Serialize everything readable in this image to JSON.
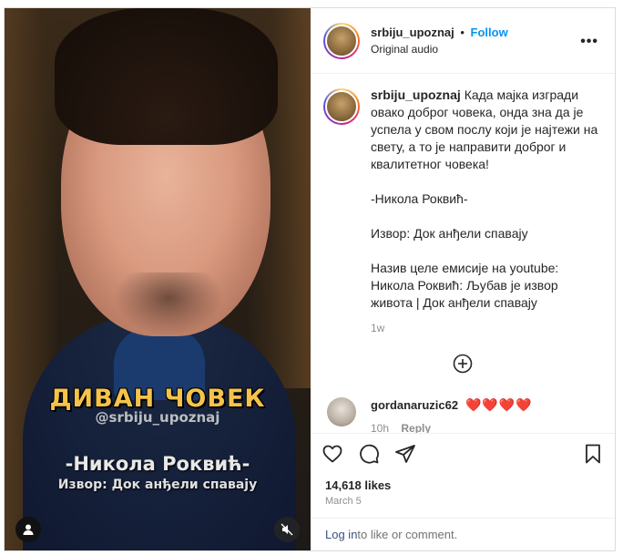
{
  "post": {
    "username": "srbiju_upoznaj",
    "separator": "•",
    "follow_label": "Follow",
    "audio": "Original audio",
    "more_label": "•••"
  },
  "video_overlay": {
    "title": "ДИВАН ЧОВЕК",
    "handle": "@srbiju_upoznaj",
    "name": "-Никола Роквић-",
    "source": "Извор: Док анђели спавају"
  },
  "caption": {
    "username": "srbiju_upoznaj",
    "paragraphs": [
      "Када мајка изгради овако доброг човека, онда зна да је успела у свом послу који је најтежи на свету, а то је направити доброг и квалитетног човека!",
      "-Никола Роквић-",
      "Извор: Док анђели спавају",
      "Назив целе емисије на youtube: Никола Роквић: Љубав је извор живота | Док анђели спавају"
    ],
    "time": "1w"
  },
  "comment": {
    "username": "gordanaruzic62",
    "text": "❤️❤️❤️❤️",
    "time": "10h",
    "reply_label": "Reply"
  },
  "stats": {
    "likes": "14,618 likes",
    "date": "March 5"
  },
  "login": {
    "link": "Log in",
    "rest": " to like or comment."
  },
  "icons": {
    "like": "heart-icon",
    "comment": "comment-icon",
    "share": "share-icon",
    "save": "bookmark-icon",
    "more": "more-icon",
    "add": "add-circle-icon",
    "user": "user-icon",
    "mute": "muted-speaker-icon"
  },
  "colors": {
    "follow": "#0095f6",
    "heart": "#e0245e",
    "overlay_title": "#f5c34a"
  }
}
